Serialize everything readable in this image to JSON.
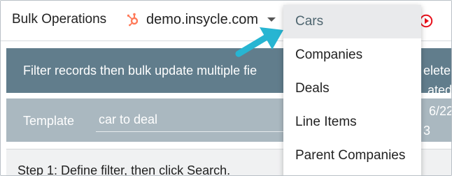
{
  "header": {
    "app_title": "Bulk Operations",
    "portal_icon": "hubspot-icon",
    "portal_name": "demo.insycle.com",
    "action_icon": "play-circle-icon"
  },
  "banner": {
    "text": "Filter records then bulk update multiple fie",
    "side_text": "elete.",
    "side_text2": "ated:"
  },
  "template": {
    "label": "Template",
    "value": "car to deal",
    "side_text": "6/22",
    "side_text2": "3"
  },
  "step": {
    "text": "Step 1: Define filter, then click Search."
  },
  "dropdown": {
    "items": [
      {
        "label": "Cars",
        "selected": true
      },
      {
        "label": "Companies",
        "selected": false
      },
      {
        "label": "Deals",
        "selected": false
      },
      {
        "label": "Line Items",
        "selected": false
      },
      {
        "label": "Parent Companies",
        "selected": false
      }
    ]
  },
  "colors": {
    "banner": "#617d8c",
    "template_row": "#aab8c0",
    "arrow": "#27b5d2",
    "hubspot": "#ff7a59",
    "play": "#e8101b"
  }
}
